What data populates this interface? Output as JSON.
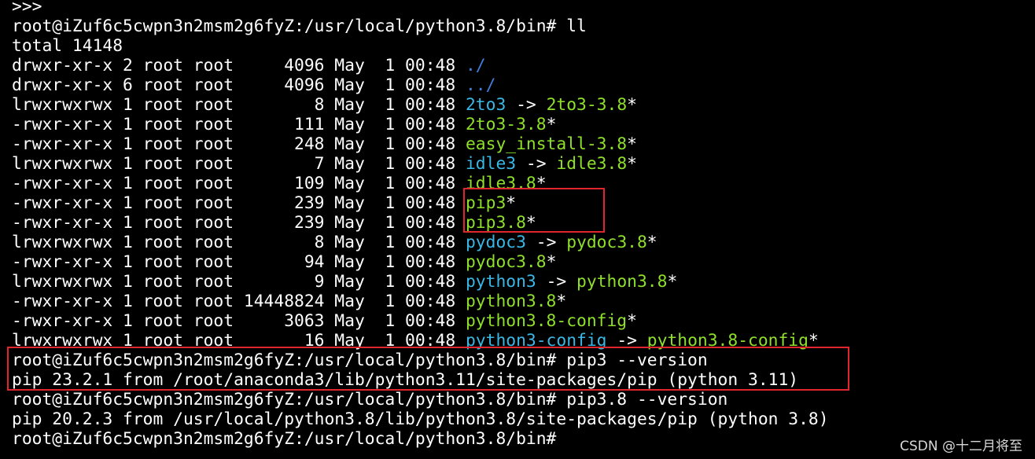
{
  "colors": {
    "background": "#000000",
    "text": "#ffffff",
    "cyan_link": "#39b8e6",
    "green_exec": "#8ee02a",
    "blue_dir": "#3f7fd9",
    "highlight_box": "#e0262c"
  },
  "terminal": {
    "lines": [
      {
        "segments": [
          {
            "text": ">>>",
            "color": "white"
          }
        ]
      },
      {
        "segments": [
          {
            "text": "root@iZuf6c5cwpn3n2msm2g6fyZ:/usr/local/python3.8/bin# ll",
            "color": "white"
          }
        ]
      },
      {
        "segments": [
          {
            "text": "total 14148",
            "color": "white"
          }
        ]
      },
      {
        "segments": [
          {
            "text": "drwxr-xr-x 2 root root     4096 May  1 00:48 ",
            "color": "white"
          },
          {
            "text": "./",
            "color": "dir"
          }
        ]
      },
      {
        "segments": [
          {
            "text": "drwxr-xr-x 6 root root     4096 May  1 00:48 ",
            "color": "white"
          },
          {
            "text": "../",
            "color": "dir"
          }
        ]
      },
      {
        "segments": [
          {
            "text": "lrwxrwxrwx 1 root root        8 May  1 00:48 ",
            "color": "white"
          },
          {
            "text": "2to3",
            "color": "cyan"
          },
          {
            "text": " -> ",
            "color": "white"
          },
          {
            "text": "2to3-3.8",
            "color": "green"
          },
          {
            "text": "*",
            "color": "white"
          }
        ]
      },
      {
        "segments": [
          {
            "text": "-rwxr-xr-x 1 root root      111 May  1 00:48 ",
            "color": "white"
          },
          {
            "text": "2to3-3.8",
            "color": "green"
          },
          {
            "text": "*",
            "color": "white"
          }
        ]
      },
      {
        "segments": [
          {
            "text": "-rwxr-xr-x 1 root root      248 May  1 00:48 ",
            "color": "white"
          },
          {
            "text": "easy_install-3.8",
            "color": "green"
          },
          {
            "text": "*",
            "color": "white"
          }
        ]
      },
      {
        "segments": [
          {
            "text": "lrwxrwxrwx 1 root root        7 May  1 00:48 ",
            "color": "white"
          },
          {
            "text": "idle3",
            "color": "cyan"
          },
          {
            "text": " -> ",
            "color": "white"
          },
          {
            "text": "idle3.8",
            "color": "green"
          },
          {
            "text": "*",
            "color": "white"
          }
        ]
      },
      {
        "segments": [
          {
            "text": "-rwxr-xr-x 1 root root      109 May  1 00:48 ",
            "color": "white"
          },
          {
            "text": "idle3.8",
            "color": "green"
          },
          {
            "text": "*",
            "color": "white"
          }
        ]
      },
      {
        "segments": [
          {
            "text": "-rwxr-xr-x 1 root root      239 May  1 00:48 ",
            "color": "white"
          },
          {
            "text": "pip3",
            "color": "green"
          },
          {
            "text": "*",
            "color": "white"
          }
        ]
      },
      {
        "segments": [
          {
            "text": "-rwxr-xr-x 1 root root      239 May  1 00:48 ",
            "color": "white"
          },
          {
            "text": "pip3.8",
            "color": "green"
          },
          {
            "text": "*",
            "color": "white"
          }
        ]
      },
      {
        "segments": [
          {
            "text": "lrwxrwxrwx 1 root root        8 May  1 00:48 ",
            "color": "white"
          },
          {
            "text": "pydoc3",
            "color": "cyan"
          },
          {
            "text": " -> ",
            "color": "white"
          },
          {
            "text": "pydoc3.8",
            "color": "green"
          },
          {
            "text": "*",
            "color": "white"
          }
        ]
      },
      {
        "segments": [
          {
            "text": "-rwxr-xr-x 1 root root       94 May  1 00:48 ",
            "color": "white"
          },
          {
            "text": "pydoc3.8",
            "color": "green"
          },
          {
            "text": "*",
            "color": "white"
          }
        ]
      },
      {
        "segments": [
          {
            "text": "lrwxrwxrwx 1 root root        9 May  1 00:48 ",
            "color": "white"
          },
          {
            "text": "python3",
            "color": "cyan"
          },
          {
            "text": " -> ",
            "color": "white"
          },
          {
            "text": "python3.8",
            "color": "green"
          },
          {
            "text": "*",
            "color": "white"
          }
        ]
      },
      {
        "segments": [
          {
            "text": "-rwxr-xr-x 1 root root 14448824 May  1 00:48 ",
            "color": "white"
          },
          {
            "text": "python3.8",
            "color": "green"
          },
          {
            "text": "*",
            "color": "white"
          }
        ]
      },
      {
        "segments": [
          {
            "text": "-rwxr-xr-x 1 root root     3063 May  1 00:48 ",
            "color": "white"
          },
          {
            "text": "python3.8-config",
            "color": "green"
          },
          {
            "text": "*",
            "color": "white"
          }
        ]
      },
      {
        "segments": [
          {
            "text": "lrwxrwxrwx 1 root root       16 May  1 00:48 ",
            "color": "white"
          },
          {
            "text": "python3-config",
            "color": "cyan"
          },
          {
            "text": " -> ",
            "color": "white"
          },
          {
            "text": "python3.8-config",
            "color": "green"
          },
          {
            "text": "*",
            "color": "white"
          }
        ]
      },
      {
        "segments": [
          {
            "text": "root@iZuf6c5cwpn3n2msm2g6fyZ:/usr/local/python3.8/bin# pip3 --version",
            "color": "white"
          }
        ]
      },
      {
        "segments": [
          {
            "text": "pip 23.2.1 from /root/anaconda3/lib/python3.11/site-packages/pip (python 3.11)",
            "color": "white"
          }
        ]
      },
      {
        "segments": [
          {
            "text": "root@iZuf6c5cwpn3n2msm2g6fyZ:/usr/local/python3.8/bin# pip3.8 --version",
            "color": "white"
          }
        ]
      },
      {
        "segments": [
          {
            "text": "pip 20.2.3 from /usr/local/python3.8/lib/python3.8/site-packages/pip (python 3.8)",
            "color": "white"
          }
        ]
      },
      {
        "segments": [
          {
            "text": "root@iZuf6c5cwpn3n2msm2g6fyZ:/usr/local/python3.8/bin#",
            "color": "white"
          }
        ]
      }
    ]
  },
  "watermark": "CSDN @十二月将至"
}
